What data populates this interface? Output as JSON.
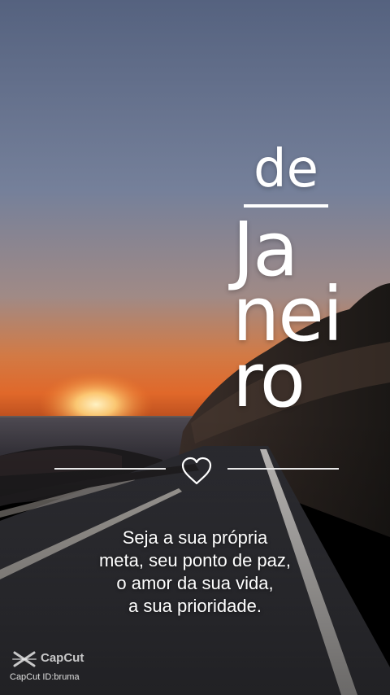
{
  "title": {
    "prefix": "de",
    "lines": [
      "Ja",
      "nei",
      "ro"
    ]
  },
  "quote": {
    "lines": [
      "Seja a sua própria",
      "meta, seu ponto de paz,",
      "o amor da sua vida,",
      "a sua prioridade."
    ]
  },
  "watermark": {
    "brand": "CapCut",
    "id_text": "CapCut ID:bruma"
  },
  "icons": [
    "heart-icon",
    "capcut-logo-icon"
  ],
  "colors": {
    "sky_top": "#55627f",
    "sky_horizon": "#d86a2a",
    "sun": "#ffd98a",
    "text": "#ffffff"
  }
}
